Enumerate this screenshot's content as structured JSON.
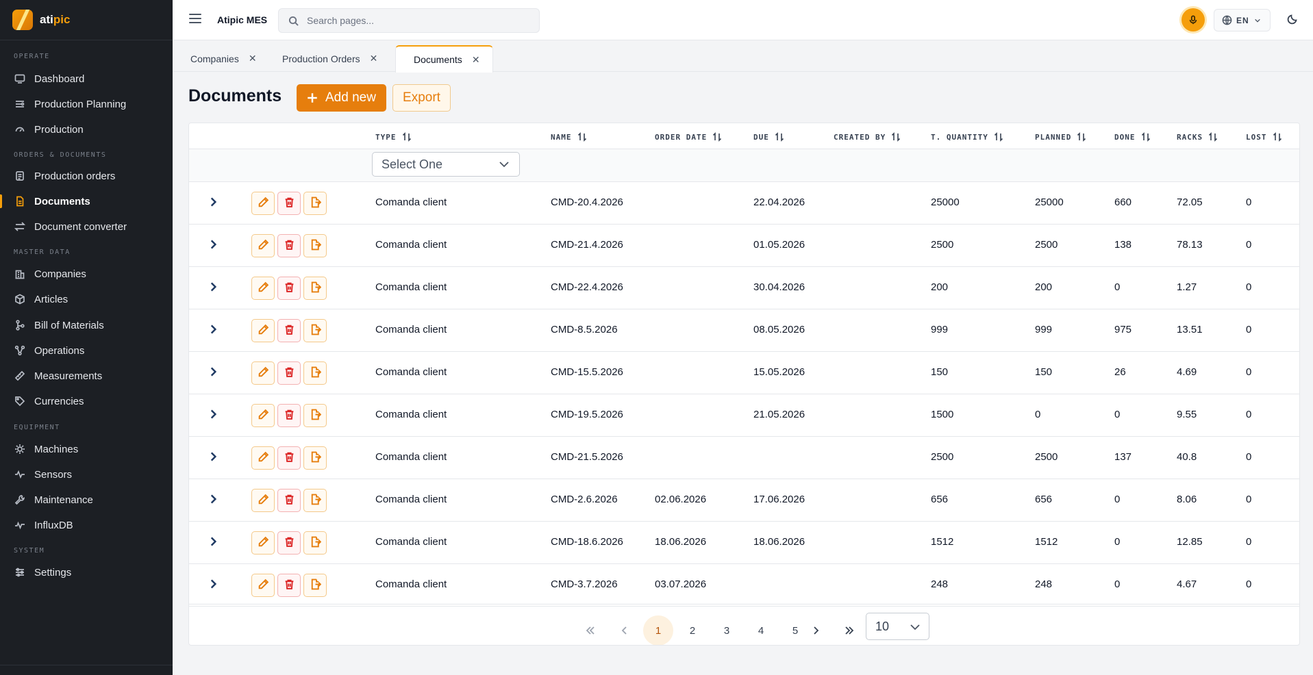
{
  "brand": {
    "prefix": "ati",
    "accent": "pic"
  },
  "sidebar": {
    "sections": [
      {
        "label": "OPERATE"
      },
      {
        "label": "ORDERS & DOCUMENTS"
      },
      {
        "label": "MASTER DATA"
      },
      {
        "label": "EQUIPMENT"
      },
      {
        "label": "SYSTEM"
      }
    ],
    "items": [
      {
        "label": "Dashboard",
        "icon": "monitor-icon"
      },
      {
        "label": "Production Planning",
        "icon": "sliders-icon"
      },
      {
        "label": "Production",
        "icon": "gauge-icon"
      },
      {
        "label": "Production orders",
        "icon": "clipboard-icon"
      },
      {
        "label": "Documents",
        "icon": "file-text-icon",
        "active": true
      },
      {
        "label": "Document converter",
        "icon": "arrows-exchange-icon"
      },
      {
        "label": "Companies",
        "icon": "building-icon"
      },
      {
        "label": "Articles",
        "icon": "box-icon"
      },
      {
        "label": "Bill of Materials",
        "icon": "hierarchy-icon"
      },
      {
        "label": "Operations",
        "icon": "workflow-icon"
      },
      {
        "label": "Measurements",
        "icon": "ruler-icon"
      },
      {
        "label": "Currencies",
        "icon": "tag-icon"
      },
      {
        "label": "Machines",
        "icon": "cog-icon"
      },
      {
        "label": "Sensors",
        "icon": "activity-icon"
      },
      {
        "label": "Maintenance",
        "icon": "wrench-icon"
      },
      {
        "label": "InfluxDB",
        "icon": "pulse-icon"
      },
      {
        "label": "Settings",
        "icon": "settings-sliders-icon"
      }
    ]
  },
  "topbar": {
    "app_title": "Atipic MES",
    "search_placeholder": "Search pages...",
    "language": "EN"
  },
  "tabs": [
    {
      "label": "Companies"
    },
    {
      "label": "Production Orders"
    },
    {
      "label": "Documents",
      "active": true
    }
  ],
  "page": {
    "title": "Documents",
    "add_label": "Add new",
    "export_label": "Export"
  },
  "table": {
    "columns": [
      "TYPE",
      "NAME",
      "ORDER DATE",
      "DUE",
      "CREATED BY",
      "T. QUANTITY",
      "PLANNED",
      "DONE",
      "RACKS",
      "LOST"
    ],
    "type_filter_placeholder": "Select One",
    "rows": [
      {
        "type": "Comanda client",
        "name": "CMD-20.4.2026",
        "order_date": "",
        "due": "22.04.2026",
        "created_by": "",
        "t_quantity": "25000",
        "planned": "25000",
        "done": "660",
        "racks": "72.05",
        "lost": "0"
      },
      {
        "type": "Comanda client",
        "name": "CMD-21.4.2026",
        "order_date": "",
        "due": "01.05.2026",
        "created_by": "",
        "t_quantity": "2500",
        "planned": "2500",
        "done": "138",
        "racks": "78.13",
        "lost": "0"
      },
      {
        "type": "Comanda client",
        "name": "CMD-22.4.2026",
        "order_date": "",
        "due": "30.04.2026",
        "created_by": "",
        "t_quantity": "200",
        "planned": "200",
        "done": "0",
        "racks": "1.27",
        "lost": "0"
      },
      {
        "type": "Comanda client",
        "name": "CMD-8.5.2026",
        "order_date": "",
        "due": "08.05.2026",
        "created_by": "",
        "t_quantity": "999",
        "planned": "999",
        "done": "975",
        "racks": "13.51",
        "lost": "0"
      },
      {
        "type": "Comanda client",
        "name": "CMD-15.5.2026",
        "order_date": "",
        "due": "15.05.2026",
        "created_by": "",
        "t_quantity": "150",
        "planned": "150",
        "done": "26",
        "racks": "4.69",
        "lost": "0"
      },
      {
        "type": "Comanda client",
        "name": "CMD-19.5.2026",
        "order_date": "",
        "due": "21.05.2026",
        "created_by": "",
        "t_quantity": "1500",
        "planned": "0",
        "done": "0",
        "racks": "9.55",
        "lost": "0"
      },
      {
        "type": "Comanda client",
        "name": "CMD-21.5.2026",
        "order_date": "",
        "due": "",
        "created_by": "",
        "t_quantity": "2500",
        "planned": "2500",
        "done": "137",
        "racks": "40.8",
        "lost": "0"
      },
      {
        "type": "Comanda client",
        "name": "CMD-2.6.2026",
        "order_date": "02.06.2026",
        "due": "17.06.2026",
        "created_by": "",
        "t_quantity": "656",
        "planned": "656",
        "done": "0",
        "racks": "8.06",
        "lost": "0"
      },
      {
        "type": "Comanda client",
        "name": "CMD-18.6.2026",
        "order_date": "18.06.2026",
        "due": "18.06.2026",
        "created_by": "",
        "t_quantity": "1512",
        "planned": "1512",
        "done": "0",
        "racks": "12.85",
        "lost": "0"
      },
      {
        "type": "Comanda client",
        "name": "CMD-3.7.2026",
        "order_date": "03.07.2026",
        "due": "",
        "created_by": "",
        "t_quantity": "248",
        "planned": "248",
        "done": "0",
        "racks": "4.67",
        "lost": "0"
      }
    ]
  },
  "pagination": {
    "pages": [
      "1",
      "2",
      "3",
      "4",
      "5"
    ],
    "current": "1",
    "per_page": "10"
  },
  "colors": {
    "accent": "#e67e0d",
    "sidebar_bg": "#1c1f24",
    "danger": "#dc2626"
  }
}
